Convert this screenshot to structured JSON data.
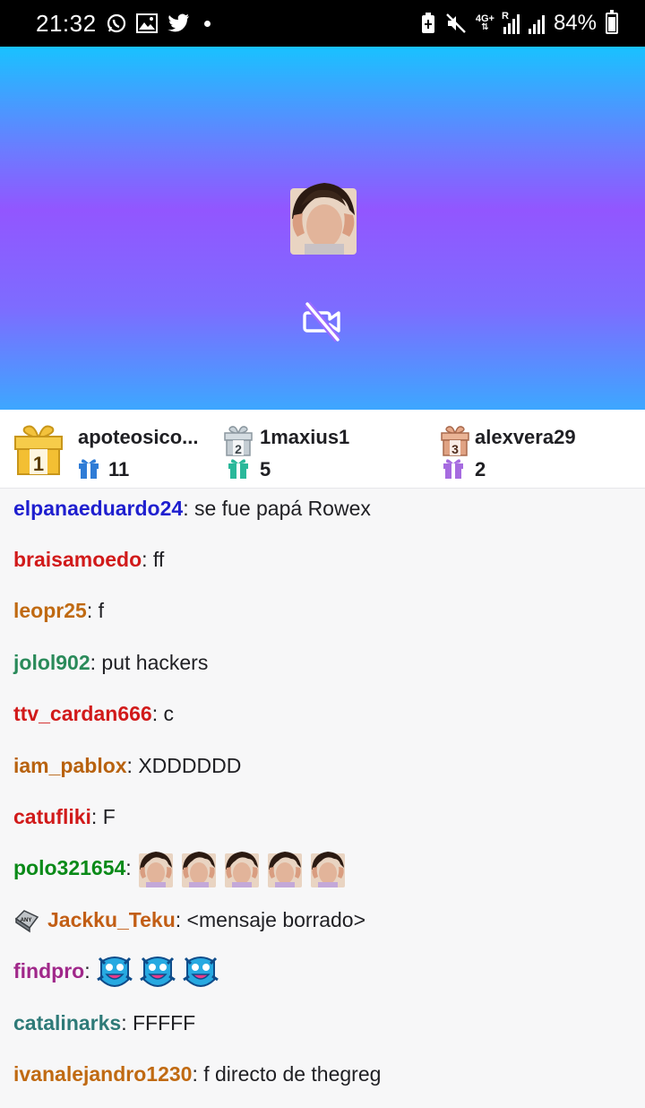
{
  "status_bar": {
    "time": "21:32",
    "left_icons": [
      "whatsapp-icon",
      "gallery-icon",
      "twitter-icon",
      "notification-dot-icon"
    ],
    "right_icons": [
      "battery-saver-icon",
      "mute-icon",
      "4g-plus-icon",
      "signal-r-icon",
      "signal-icon"
    ],
    "network_label": "4G+",
    "roaming_label": "R",
    "battery_percent": "84%"
  },
  "video": {
    "avatar_icon": "streamer-avatar-emote",
    "camera_off_icon": "camera-off-icon",
    "gradient_colors": [
      "#19c2ff",
      "#9256ff",
      "#3da7ff"
    ]
  },
  "leaderboard": {
    "entries": [
      {
        "rank": "1",
        "name": "apoteosico...",
        "count": "11",
        "rank_icon": "gold-gift-rank-1-icon",
        "gift_color": "#2f7cd6"
      },
      {
        "rank": "2",
        "name": "1maxius1",
        "count": "5",
        "rank_icon": "silver-gift-rank-2-icon",
        "gift_color": "#2ab89a"
      },
      {
        "rank": "3",
        "name": "alexvera29",
        "count": "2",
        "rank_icon": "bronze-gift-rank-3-icon",
        "gift_color": "#a66be0"
      }
    ]
  },
  "chat": {
    "messages": [
      {
        "user": "elpanaeduardo24",
        "color": "#1f1fcf",
        "text": ": se fue papá Rowex"
      },
      {
        "user": "braisamoedo",
        "color": "#d11a1a",
        "text": ": ff"
      },
      {
        "user": "leopr25",
        "color": "#c06a12",
        "text": ": f"
      },
      {
        "user": "jolol902",
        "color": "#2a8a5a",
        "text": ": put hackers"
      },
      {
        "user": "ttv_cardan666",
        "color": "#d11a1a",
        "text": ": c"
      },
      {
        "user": "iam_pablox",
        "color": "#b8620f",
        "text": ": XDDDDDD"
      },
      {
        "user": "catufliki",
        "color": "#d11a1a",
        "text": ": F"
      },
      {
        "user": "polo321654",
        "color": "#0a8a18",
        "text": ":",
        "emotes": [
          "facepalm-emote",
          "facepalm-emote",
          "facepalm-emote",
          "facepalm-emote",
          "facepalm-emote"
        ]
      },
      {
        "user": "Jackku_Teku",
        "color": "#c25e15",
        "text": ": <mensaje borrado>",
        "badge": "any-badge-icon"
      },
      {
        "user": "findpro",
        "color": "#a0288a",
        "text": ":",
        "emotes": [
          "blue-monster-emote",
          "blue-monster-emote",
          "blue-monster-emote"
        ]
      },
      {
        "user": "catalinarks",
        "color": "#2e7a78",
        "text": ": FFFFF"
      },
      {
        "user": "ivanalejandro1230",
        "color": "#c06a12",
        "text": ": f directo de thegreg"
      }
    ]
  }
}
